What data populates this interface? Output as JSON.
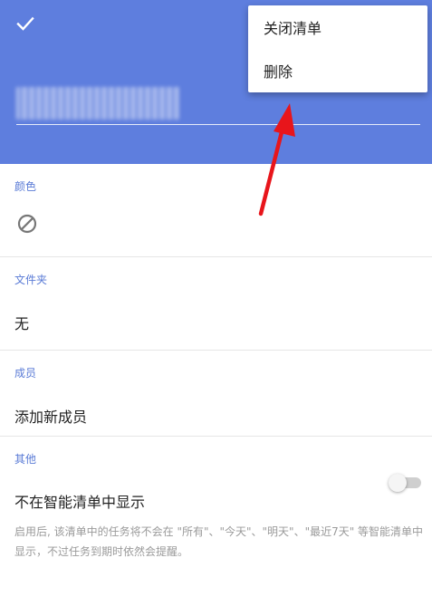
{
  "header": {
    "background_color": "#5e7ede",
    "confirm_icon": "check-icon"
  },
  "menu": {
    "items": [
      {
        "label": "关闭清单"
      },
      {
        "label": "删除"
      }
    ]
  },
  "sections": {
    "color": {
      "label": "颜色",
      "icon": "no-color-icon"
    },
    "folder": {
      "label": "文件夹",
      "value": "无"
    },
    "members": {
      "label": "成员",
      "action": "添加新成员"
    },
    "other": {
      "label": "其他",
      "toggle_label": "不在智能清单中显示",
      "toggle_on": false,
      "description": "启用后, 该清单中的任务将不会在 \"所有\"、\"今天\"、\"明天\"、\"最近7天\" 等智能清单中显示，不过任务到期时依然会提醒。"
    }
  },
  "colors": {
    "accent": "#5a7bd6",
    "annotation_arrow": "#e8151b"
  }
}
